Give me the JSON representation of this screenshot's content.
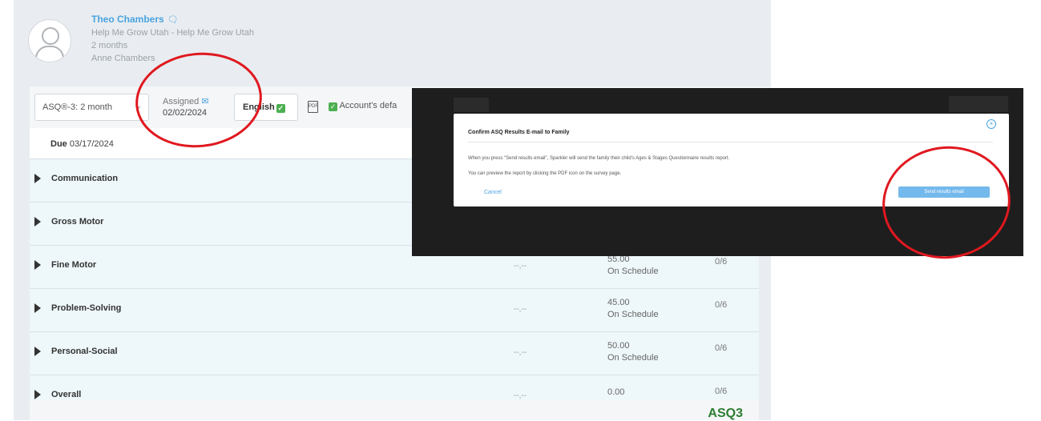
{
  "profile": {
    "name": "Theo Chambers",
    "program": "Help Me Grow Utah - Help Me Grow Utah",
    "age": "2 months",
    "guardian": "Anne Chambers"
  },
  "toolbar": {
    "questionnaire": "ASQ®-3: 2 month",
    "assigned_label": "Assigned",
    "assigned_date": "02/02/2024",
    "language": "English",
    "pdf_icon": "pdf-icon",
    "account_default": "Account's defa"
  },
  "due": {
    "label": "Due",
    "date": "03/17/2024"
  },
  "domains": [
    {
      "name": "Communication"
    },
    {
      "name": "Gross Motor"
    },
    {
      "name": "Fine Motor",
      "dash": "--,--",
      "score": "55.00",
      "status": "On Schedule",
      "count": "0/6"
    },
    {
      "name": "Problem-Solving",
      "dash": "--,--",
      "score": "45.00",
      "status": "On Schedule",
      "count": "0/6"
    },
    {
      "name": "Personal-Social",
      "dash": "--,--",
      "score": "50.00",
      "status": "On Schedule",
      "count": "0/6"
    },
    {
      "name": "Overall",
      "dash": "--,--",
      "score": "0.00",
      "status": "",
      "count": "0/6"
    }
  ],
  "footer": {
    "logo": "ASQ3"
  },
  "modal": {
    "title": "Confirm ASQ Results E-mail to Family",
    "line1": "When you press \"Send results email\", Sparkler will send the family their child's Ages & Stages Questionnaire results report.",
    "line2": "You can preview the report by clicking the PDF icon on the survey page.",
    "cancel": "Cancel",
    "send": "Send results email",
    "close_icon": "close-icon"
  },
  "colors": {
    "accent": "#4aa3df",
    "annotation": "#e0181f",
    "check": "#4caf50"
  }
}
